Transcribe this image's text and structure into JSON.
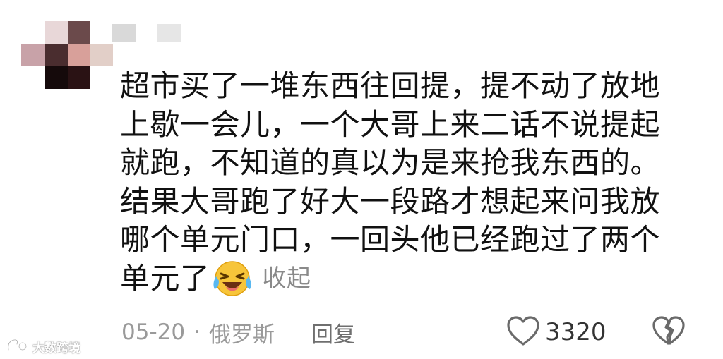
{
  "comment": {
    "lines": [
      "超市买了一堆东西往回提，提不动了放地",
      "上歇一会儿，一个大哥上来二话不说提起",
      "就跑，不知道的真以为是来抢我东西的。",
      "结果大哥跑了好大一段路才想起来问我放",
      "哪个单元门口，一回头他已经跑过了两个",
      "单元了"
    ],
    "emoji": "laughing-crying-emoji",
    "collapse_label": "收起"
  },
  "meta": {
    "date": "05-20",
    "separator": "·",
    "location": "俄罗斯",
    "reply_label": "回复"
  },
  "actions": {
    "like_count": "3320",
    "like_icon": "heart-outline-icon",
    "dislike_icon": "broken-heart-icon"
  },
  "watermark": {
    "text": "大数跨境"
  }
}
